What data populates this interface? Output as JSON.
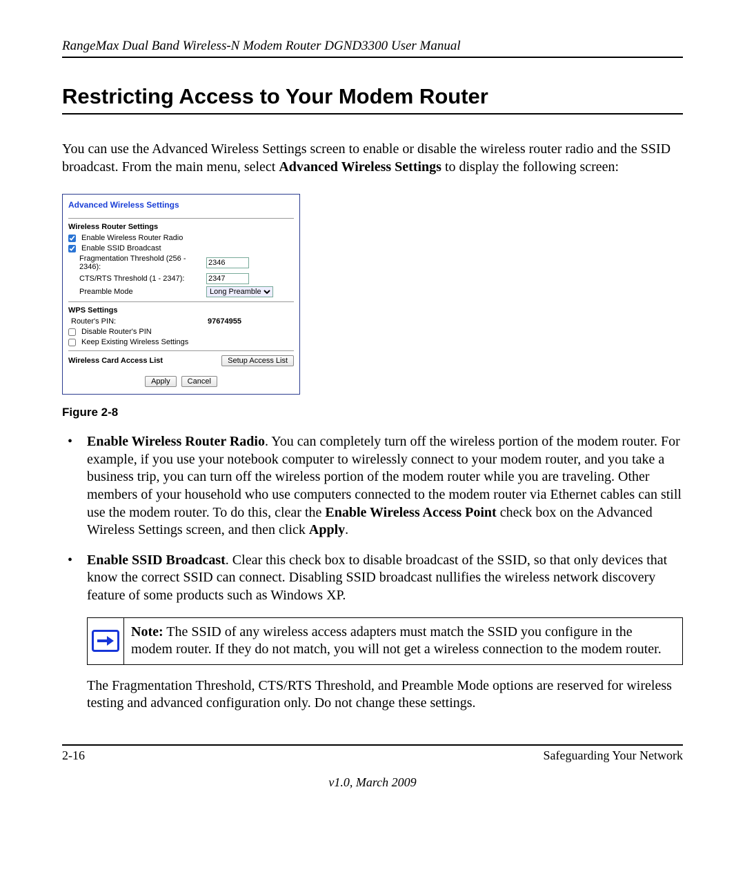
{
  "runningHead": "RangeMax Dual Band Wireless-N Modem Router DGND3300 User Manual",
  "title": "Restricting Access to Your Modem Router",
  "intro": {
    "pre": "You can use the Advanced Wireless Settings screen to enable or disable the wireless router radio and the SSID broadcast. From the main menu, select ",
    "bold": "Advanced Wireless Settings",
    "post": " to display the following screen:"
  },
  "panel": {
    "title": "Advanced Wireless Settings",
    "section1": {
      "heading": "Wireless Router Settings",
      "enableRadio": "Enable Wireless Router Radio",
      "enableSsid": "Enable SSID Broadcast",
      "fragLabel": "Fragmentation Threshold (256 - 2346):",
      "fragValue": "2346",
      "ctsLabel": "CTS/RTS Threshold (1 - 2347):",
      "ctsValue": "2347",
      "preambleLabel": "Preamble Mode",
      "preambleValue": "Long Preamble"
    },
    "section2": {
      "heading": "WPS Settings",
      "pinLabel": "Router's PIN:",
      "pinValue": "97674955",
      "disablePin": "Disable Router's PIN",
      "keepExisting": "Keep Existing Wireless Settings"
    },
    "section3": {
      "heading": "Wireless Card Access List",
      "setupBtn": "Setup Access List"
    },
    "applyBtn": "Apply",
    "cancelBtn": "Cancel"
  },
  "figureLabel": "Figure 2-8",
  "bullet1": {
    "lead": "Enable Wireless Router Radio",
    "body1": ". You can completely turn off the wireless portion of the modem router. For example, if you use your notebook computer to wirelessly connect to your modem router, and you take a business trip, you can turn off the wireless portion of the modem router while you are traveling. Other members of your household who use computers connected to the modem router via Ethernet cables can still use the modem router. To do this, clear the ",
    "bold1": "Enable Wireless Access Point",
    "body2": " check box on the Advanced Wireless Settings screen, and then click ",
    "bold2": "Apply",
    "body3": "."
  },
  "bullet2": {
    "lead": "Enable SSID Broadcast",
    "body": ". Clear this check box to disable broadcast of the SSID, so that only devices that know the correct SSID can connect. Disabling SSID broadcast nullifies the wireless network discovery feature of some products such as Windows XP."
  },
  "note": {
    "lead": "Note:",
    "body": " The SSID of any wireless access adapters must match the SSID you configure in the modem router. If they do not match, you will not get a wireless connection to the modem router."
  },
  "afterNote": "The Fragmentation Threshold, CTS/RTS Threshold, and Preamble Mode options are reserved for wireless testing and advanced configuration only. Do not change these settings.",
  "footer": {
    "left": "2-16",
    "right": "Safeguarding Your Network",
    "version": "v1.0, March 2009"
  }
}
